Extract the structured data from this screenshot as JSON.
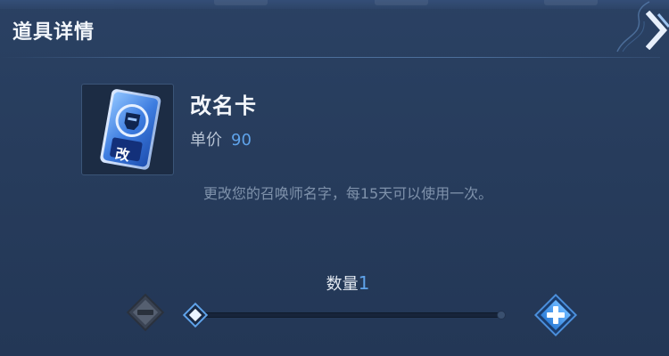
{
  "dialog": {
    "title": "道具详情",
    "close_icon": "close-chevron-icon"
  },
  "item": {
    "name": "改名卡",
    "price_label": "单价",
    "price_value": "90",
    "icon_glyph": "改",
    "description": "更改您的召唤师名字，每15天可以使用一次。"
  },
  "quantity": {
    "label": "数量",
    "value": "1",
    "slider_level": 0.0
  },
  "colors": {
    "accent": "#5fa3ea",
    "background": "#273c5c"
  }
}
